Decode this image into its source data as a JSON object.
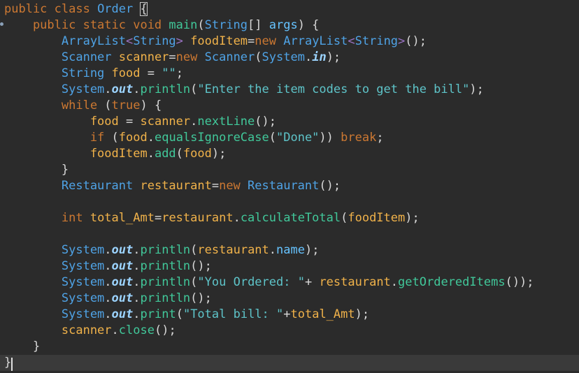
{
  "editor": {
    "lines": [
      [
        [
          "kw",
          "public class "
        ],
        [
          "type",
          "Order "
        ],
        [
          "box",
          "{"
        ]
      ],
      [
        [
          "kw",
          "    public static void "
        ],
        [
          "method",
          "main"
        ],
        [
          "txt",
          "("
        ],
        [
          "type",
          "String"
        ],
        [
          "txt",
          "[] "
        ],
        [
          "fld",
          "args"
        ],
        [
          "txt",
          ") {"
        ]
      ],
      [
        [
          "type",
          "        ArrayList"
        ],
        [
          "gen",
          "<"
        ],
        [
          "type",
          "String"
        ],
        [
          "gen",
          "> "
        ],
        [
          "var",
          "foodItem"
        ],
        [
          "txt",
          "="
        ],
        [
          "kw",
          "new "
        ],
        [
          "type",
          "ArrayList"
        ],
        [
          "gen",
          "<"
        ],
        [
          "type",
          "String"
        ],
        [
          "gen",
          ">"
        ],
        [
          "txt",
          "();"
        ]
      ],
      [
        [
          "type",
          "        Scanner "
        ],
        [
          "var",
          "scanner"
        ],
        [
          "txt",
          "="
        ],
        [
          "kw",
          "new "
        ],
        [
          "type",
          "Scanner"
        ],
        [
          "txt",
          "("
        ],
        [
          "type",
          "System"
        ],
        [
          "txt",
          "."
        ],
        [
          "static",
          "in"
        ],
        [
          "txt",
          ");"
        ]
      ],
      [
        [
          "type",
          "        String "
        ],
        [
          "var",
          "food"
        ],
        [
          "txt",
          " = "
        ],
        [
          "str",
          "\"\""
        ],
        [
          "txt",
          ";"
        ]
      ],
      [
        [
          "type",
          "        System"
        ],
        [
          "txt",
          "."
        ],
        [
          "static",
          "out"
        ],
        [
          "txt",
          "."
        ],
        [
          "method",
          "println"
        ],
        [
          "txt",
          "("
        ],
        [
          "str",
          "\"Enter the item codes to get the bill\""
        ],
        [
          "txt",
          ");"
        ]
      ],
      [
        [
          "kw",
          "        while "
        ],
        [
          "txt",
          "("
        ],
        [
          "kw",
          "true"
        ],
        [
          "txt",
          ") {"
        ]
      ],
      [
        [
          "var",
          "            food"
        ],
        [
          "txt",
          " = "
        ],
        [
          "var",
          "scanner"
        ],
        [
          "txt",
          "."
        ],
        [
          "method",
          "nextLine"
        ],
        [
          "txt",
          "();"
        ]
      ],
      [
        [
          "kw",
          "            if "
        ],
        [
          "txt",
          "("
        ],
        [
          "var",
          "food"
        ],
        [
          "txt",
          "."
        ],
        [
          "method",
          "equalsIgnoreCase"
        ],
        [
          "txt",
          "("
        ],
        [
          "str",
          "\"Done\""
        ],
        [
          "txt",
          ")) "
        ],
        [
          "kw",
          "break"
        ],
        [
          "txt",
          ";"
        ]
      ],
      [
        [
          "var",
          "            foodItem"
        ],
        [
          "txt",
          "."
        ],
        [
          "method",
          "add"
        ],
        [
          "txt",
          "("
        ],
        [
          "var",
          "food"
        ],
        [
          "txt",
          ");"
        ]
      ],
      [
        [
          "txt",
          "        }"
        ]
      ],
      [
        [
          "type",
          "        Restaurant "
        ],
        [
          "var",
          "restaurant"
        ],
        [
          "txt",
          "="
        ],
        [
          "kw",
          "new "
        ],
        [
          "type",
          "Restaurant"
        ],
        [
          "txt",
          "();"
        ]
      ],
      [],
      [
        [
          "kw",
          "        int "
        ],
        [
          "var",
          "total_Amt"
        ],
        [
          "txt",
          "="
        ],
        [
          "var",
          "restaurant"
        ],
        [
          "txt",
          "."
        ],
        [
          "method",
          "calculateTotal"
        ],
        [
          "txt",
          "("
        ],
        [
          "var",
          "foodItem"
        ],
        [
          "txt",
          ");"
        ]
      ],
      [],
      [
        [
          "type",
          "        System"
        ],
        [
          "txt",
          "."
        ],
        [
          "static",
          "out"
        ],
        [
          "txt",
          "."
        ],
        [
          "method",
          "println"
        ],
        [
          "txt",
          "("
        ],
        [
          "var",
          "restaurant"
        ],
        [
          "txt",
          "."
        ],
        [
          "fld",
          "name"
        ],
        [
          "txt",
          ");"
        ]
      ],
      [
        [
          "type",
          "        System"
        ],
        [
          "txt",
          "."
        ],
        [
          "static",
          "out"
        ],
        [
          "txt",
          "."
        ],
        [
          "method",
          "println"
        ],
        [
          "txt",
          "();"
        ]
      ],
      [
        [
          "type",
          "        System"
        ],
        [
          "txt",
          "."
        ],
        [
          "static",
          "out"
        ],
        [
          "txt",
          "."
        ],
        [
          "method",
          "println"
        ],
        [
          "txt",
          "("
        ],
        [
          "str",
          "\"You Ordered: \""
        ],
        [
          "txt",
          "+ "
        ],
        [
          "var",
          "restaurant"
        ],
        [
          "txt",
          "."
        ],
        [
          "method",
          "getOrderedItems"
        ],
        [
          "txt",
          "());"
        ]
      ],
      [
        [
          "type",
          "        System"
        ],
        [
          "txt",
          "."
        ],
        [
          "static",
          "out"
        ],
        [
          "txt",
          "."
        ],
        [
          "method",
          "println"
        ],
        [
          "txt",
          "();"
        ]
      ],
      [
        [
          "type",
          "        System"
        ],
        [
          "txt",
          "."
        ],
        [
          "static",
          "out"
        ],
        [
          "txt",
          "."
        ],
        [
          "method",
          "print"
        ],
        [
          "txt",
          "("
        ],
        [
          "str",
          "\"Total bill: \""
        ],
        [
          "txt",
          "+"
        ],
        [
          "var",
          "total_Amt"
        ],
        [
          "txt",
          ");"
        ]
      ],
      [
        [
          "var",
          "        scanner"
        ],
        [
          "txt",
          "."
        ],
        [
          "method",
          "close"
        ],
        [
          "txt",
          "();"
        ]
      ],
      [
        [
          "txt",
          "    }"
        ]
      ],
      [
        [
          "txt",
          "}"
        ]
      ]
    ]
  }
}
